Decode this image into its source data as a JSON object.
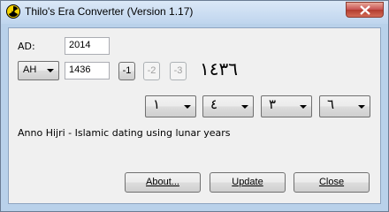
{
  "window": {
    "title": "Thilo's Era Converter (Version 1.17)"
  },
  "icons": {
    "app": "radiation-icon",
    "close": "close-icon"
  },
  "colors": {
    "close_button": "#c75050",
    "title_bar": "#bfd5ee"
  },
  "form": {
    "ad_label": "AD:",
    "ad_value": "2014",
    "era_select": "AH",
    "era_year_value": "1436",
    "minus1_label": "-1",
    "minus2_label": "-2",
    "minus3_label": "-3",
    "arabic_year_display": "١٤٣٦",
    "digit_selects": [
      "١",
      "٤",
      "٣",
      "٦"
    ],
    "description": "Anno Hijri - Islamic dating using lunar years"
  },
  "buttons": {
    "about": "About...",
    "update": "Update",
    "close": "Close"
  }
}
